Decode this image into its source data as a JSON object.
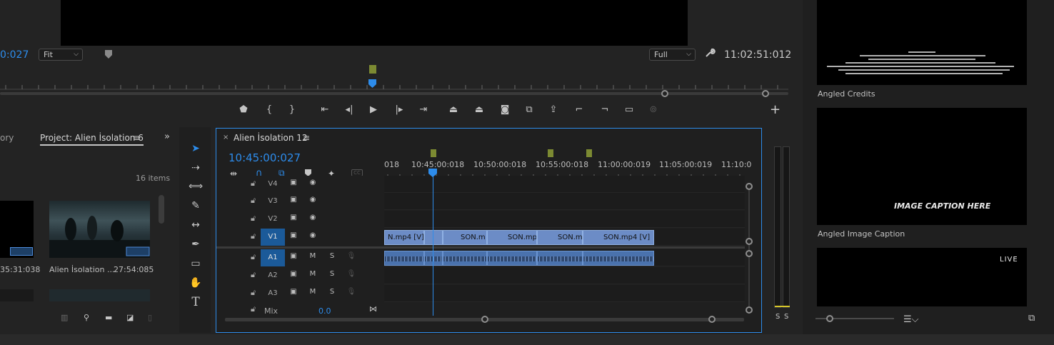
{
  "monitor": {
    "timecode_left": "0:027",
    "zoom": "Fit",
    "resolution": "Full",
    "timecode_right": "11:02:51:012"
  },
  "project": {
    "tab_history": "ory",
    "tab_project": "Project: Alien İsolation 6",
    "items_count": "16 items",
    "clip1_duration": "35:31:038",
    "clip2_name": "Alien İsolation ...",
    "clip2_duration": "27:54:085"
  },
  "sequence": {
    "title": "Alien İsolation 12",
    "timecode": "10:45:00:027",
    "ruler_labels": [
      "018",
      "10:45:00:018",
      "10:50:00:018",
      "10:55:00:018",
      "11:00:00:019",
      "11:05:00:019",
      "11:10:0"
    ],
    "video_tracks": [
      "V4",
      "V3",
      "V2",
      "V1"
    ],
    "audio_tracks": [
      "A1",
      "A2",
      "A3"
    ],
    "mix_label": "Mix",
    "mix_value": "0.0",
    "v1_clips": [
      "N.mp4 [V]",
      "SON.m",
      "SON.mp",
      "SON.m",
      "SON.mp4 [V]"
    ],
    "btn_m": "M",
    "btn_s": "S"
  },
  "meters": {
    "s_left": "S",
    "s_right": "S"
  },
  "graphics": [
    {
      "label": "Angled Credits",
      "overlay": ""
    },
    {
      "label": "Angled Image Caption",
      "overlay": "IMAGE CAPTION HERE"
    },
    {
      "label": "",
      "overlay": "LIVE"
    }
  ]
}
